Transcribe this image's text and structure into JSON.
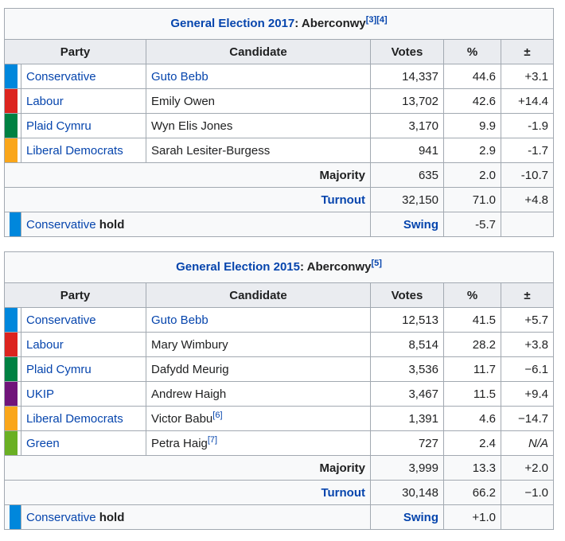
{
  "colors": {
    "Conservative": "#0087DC",
    "Labour": "#DC241F",
    "Plaid Cymru": "#008142",
    "Liberal Democrats": "#FAA61A",
    "UKIP": "#70147A",
    "Green": "#6AB023"
  },
  "headers": {
    "party": "Party",
    "candidate": "Candidate",
    "votes": "Votes",
    "pct": "%",
    "change": "±"
  },
  "e2017": {
    "caption_link": "General Election 2017",
    "caption_rest": ": Aberconwy",
    "caption_refs": "[3][4]",
    "rows": [
      {
        "party": "Conservative",
        "candidate": "Guto Bebb",
        "candidate_link": true,
        "votes": "14,337",
        "pct": "44.6",
        "change": "+3.1"
      },
      {
        "party": "Labour",
        "candidate": "Emily Owen",
        "votes": "13,702",
        "pct": "42.6",
        "change": "+14.4"
      },
      {
        "party": "Plaid Cymru",
        "candidate": "Wyn Elis Jones",
        "votes": "3,170",
        "pct": "9.9",
        "change": "-1.9"
      },
      {
        "party": "Liberal Democrats",
        "candidate": "Sarah Lesiter-Burgess",
        "votes": "941",
        "pct": "2.9",
        "change": "-1.7"
      }
    ],
    "majority": {
      "label": "Majority",
      "votes": "635",
      "pct": "2.0",
      "change": "-10.7"
    },
    "turnout": {
      "label": "Turnout",
      "votes": "32,150",
      "pct": "71.0",
      "change": "+4.8"
    },
    "hold": {
      "party": "Conservative",
      "word": "hold",
      "swing_label": "Swing",
      "swing": "-5.7"
    }
  },
  "e2015": {
    "caption_link": "General Election 2015",
    "caption_rest": ": Aberconwy",
    "caption_refs": "[5]",
    "rows": [
      {
        "party": "Conservative",
        "candidate": "Guto Bebb",
        "candidate_link": true,
        "votes": "12,513",
        "pct": "41.5",
        "change": "+5.7"
      },
      {
        "party": "Labour",
        "candidate": "Mary Wimbury",
        "votes": "8,514",
        "pct": "28.2",
        "change": "+3.8"
      },
      {
        "party": "Plaid Cymru",
        "candidate": "Dafydd Meurig",
        "votes": "3,536",
        "pct": "11.7",
        "change": "−6.1"
      },
      {
        "party": "UKIP",
        "candidate": "Andrew Haigh",
        "votes": "3,467",
        "pct": "11.5",
        "change": "+9.4"
      },
      {
        "party": "Liberal Democrats",
        "candidate": "Victor Babu",
        "ref": "[6]",
        "votes": "1,391",
        "pct": "4.6",
        "change": "−14.7"
      },
      {
        "party": "Green",
        "candidate": "Petra Haig",
        "ref": "[7]",
        "votes": "727",
        "pct": "2.4",
        "change": "N/A"
      }
    ],
    "majority": {
      "label": "Majority",
      "votes": "3,999",
      "pct": "13.3",
      "change": "+2.0"
    },
    "turnout": {
      "label": "Turnout",
      "votes": "30,148",
      "pct": "66.2",
      "change": "−1.0"
    },
    "hold": {
      "party": "Conservative",
      "word": "hold",
      "swing_label": "Swing",
      "swing": "+1.0"
    }
  }
}
